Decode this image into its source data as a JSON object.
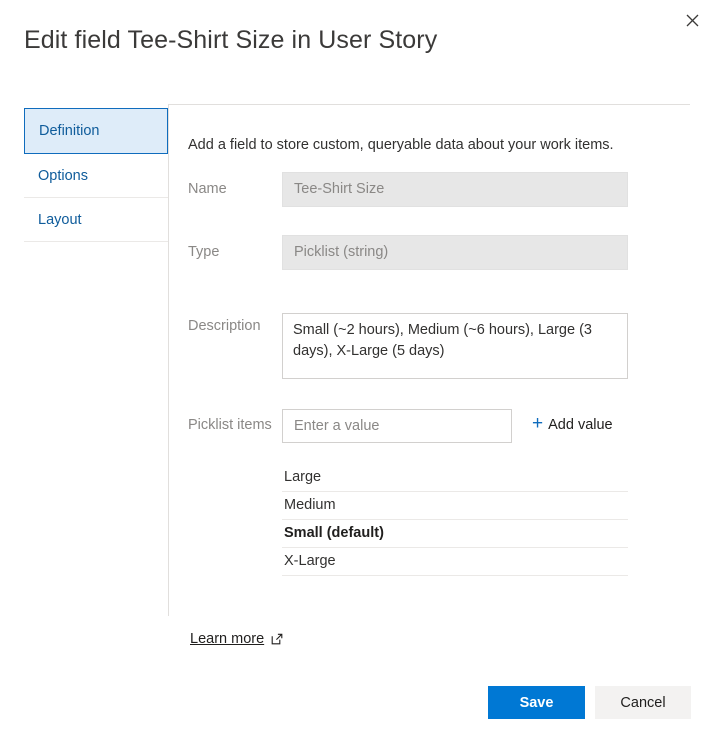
{
  "dialog": {
    "title": "Edit field Tee-Shirt Size in User Story",
    "close_label": "Close"
  },
  "nav": {
    "items": [
      {
        "label": "Definition",
        "selected": true
      },
      {
        "label": "Options",
        "selected": false
      },
      {
        "label": "Layout",
        "selected": false
      }
    ]
  },
  "main": {
    "intro": "Add a field to store custom, queryable data about your work items.",
    "name": {
      "label": "Name",
      "value": "Tee-Shirt Size"
    },
    "type": {
      "label": "Type",
      "value": "Picklist (string)"
    },
    "description": {
      "label": "Description",
      "value": "Small (~2 hours), Medium (~6 hours), Large (3 days), X-Large (5 days)"
    },
    "picklist": {
      "label": "Picklist items",
      "input_placeholder": "Enter a value",
      "input_value": "",
      "add_value_label": "Add value",
      "add_value_plus": "+",
      "items": [
        {
          "label": "Large",
          "default": false
        },
        {
          "label": "Medium",
          "default": false
        },
        {
          "label": "Small (default)",
          "default": true
        },
        {
          "label": "X-Large",
          "default": false
        }
      ]
    },
    "learn_more": "Learn more"
  },
  "footer": {
    "save_label": "Save",
    "cancel_label": "Cancel"
  },
  "colors": {
    "accent": "#0078d4",
    "tab_selected_bg": "#deecf9",
    "tab_selected_border": "#0f6cbd",
    "link_blue": "#0f5c9b",
    "readonly_bg": "#e7e7e7"
  }
}
